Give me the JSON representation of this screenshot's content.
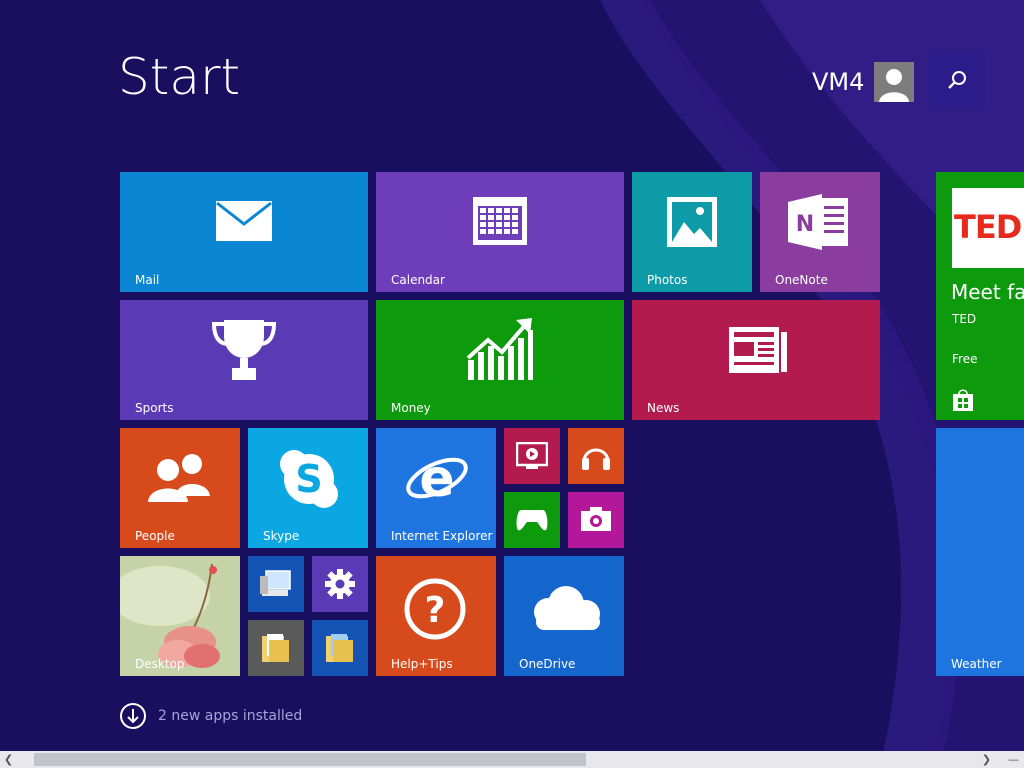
{
  "header": {
    "title": "Start",
    "user_name": "VM4"
  },
  "tiles": {
    "mail": "Mail",
    "calendar": "Calendar",
    "photos": "Photos",
    "onenote": "OneNote",
    "sports": "Sports",
    "money": "Money",
    "news": "News",
    "people": "People",
    "skype": "Skype",
    "internet_explorer": "Internet Explorer",
    "desktop": "Desktop",
    "help_tips": "Help+Tips",
    "onedrive": "OneDrive",
    "weather": "Weather"
  },
  "ted_tile": {
    "logo": "TED",
    "headline": "Meet fas",
    "publisher": "TED",
    "price": "Free"
  },
  "notice": {
    "text": "2 new apps installed"
  },
  "colors": {
    "background": "#1a0f5e",
    "mail": "#0a86d3",
    "calendar": "#6e3db9",
    "photos": "#0e9ba8",
    "onenote": "#8a3d9e",
    "sports": "#5a3bb5",
    "money": "#0d9a0d",
    "news": "#b31b4f",
    "people": "#d64a1c",
    "skype": "#0aa7e2",
    "internet_explorer": "#1f75e0",
    "help_tips": "#d64a1c",
    "onedrive": "#1466cc",
    "weather": "#1f75e0",
    "ted_store": "#0d9a0d"
  }
}
